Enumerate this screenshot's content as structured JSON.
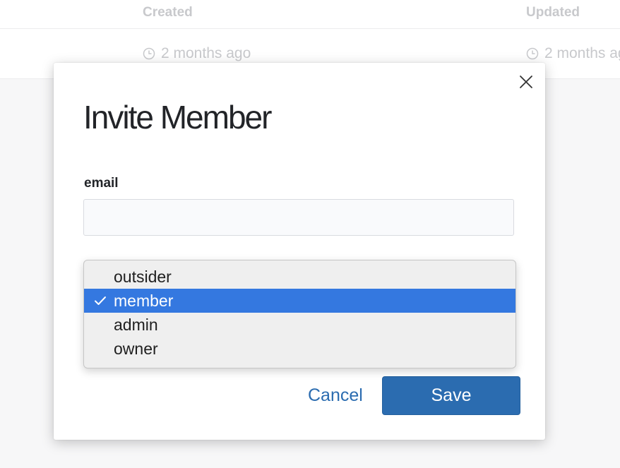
{
  "table": {
    "headers": {
      "created": "Created",
      "updated": "Updated"
    },
    "row": {
      "created": "2 months ago",
      "updated": "2 months ago"
    },
    "icon": "clock-icon"
  },
  "modal": {
    "title": "Invite Member",
    "close_icon": "close-icon",
    "email_label": "email",
    "email_value": "",
    "email_placeholder": "",
    "cancel_label": "Cancel",
    "save_label": "Save"
  },
  "role_dropdown": {
    "selected": "member",
    "options": [
      "outsider",
      "member",
      "admin",
      "owner"
    ],
    "check_icon": "checkmark-icon"
  },
  "colors": {
    "primary": "#2b6cb0",
    "selection": "#3478e0"
  }
}
